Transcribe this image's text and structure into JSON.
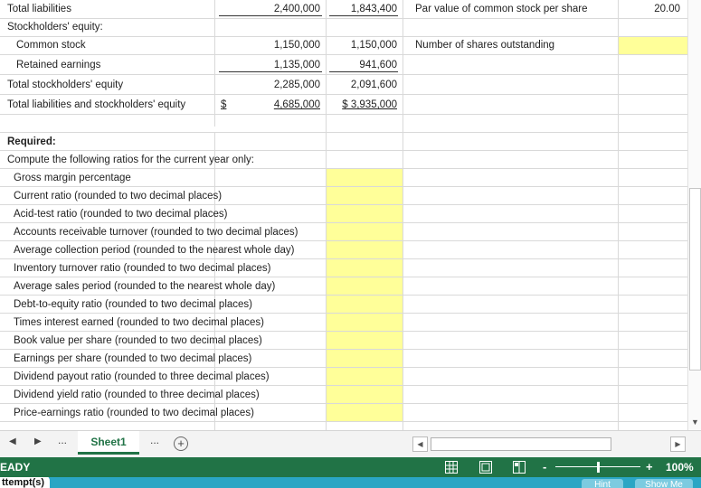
{
  "balance_rows": [
    {
      "label": "Total liabilities",
      "current": "2,400,000",
      "prior": "1,843,400"
    },
    {
      "label": "Stockholders' equity:",
      "current": "",
      "prior": ""
    },
    {
      "label": "Common stock",
      "current": "1,150,000",
      "prior": "1,150,000"
    },
    {
      "label": "Retained earnings",
      "current": "1,135,000",
      "prior": "941,600"
    },
    {
      "label": "Total stockholders' equity",
      "current": "2,285,000",
      "prior": "2,091,600"
    },
    {
      "label": "Total liabilities and stockholders' equity",
      "dollar_sign": "$",
      "current": "4,685,000",
      "prior": "$ 3,935,000"
    }
  ],
  "side_info": [
    {
      "label": "Par value of common stock per share",
      "value": "20.00"
    },
    {
      "label": "Number of shares outstanding",
      "value": ""
    }
  ],
  "required": {
    "heading": "Required:",
    "instruction": "Compute the following ratios for the current year only:",
    "ratios": [
      "Gross margin percentage",
      "Current ratio (rounded to two decimal places)",
      "Acid-test ratio (rounded to two decimal places)",
      "Accounts receivable turnover (rounded to two decimal places)",
      "Average collection period (rounded to the nearest whole day)",
      "Inventory turnover ratio (rounded to two decimal places)",
      "Average sales period (rounded to the nearest whole day)",
      "Debt-to-equity ratio (rounded to two decimal places)",
      "Times interest earned (rounded to two decimal places)",
      "Book value per share (rounded to two decimal places)",
      "Earnings per share (rounded to two decimal places)",
      "Dividend payout ratio (rounded to three decimal places)",
      "Dividend yield ratio (rounded to three decimal places)",
      "Price-earnings ratio (rounded to two decimal places)"
    ]
  },
  "tabs": {
    "nav_prev": "◀",
    "nav_next": "▶",
    "ellipsis_left": "...",
    "active_sheet": "Sheet1",
    "ellipsis_right": "...",
    "add_sheet": "+"
  },
  "statusbar": {
    "status": "EADY",
    "zoom_minus": "-",
    "zoom_plus": "+",
    "zoom_level": "100%",
    "zoom_fraction": 0.5
  },
  "bottombar": {
    "attempts": "ttempt(s)",
    "hint": "Hint",
    "show_me": "Show Me"
  },
  "colors": {
    "input_highlight": "#ffff99",
    "status_green": "#217346",
    "accent_teal": "#2aa6c4"
  }
}
